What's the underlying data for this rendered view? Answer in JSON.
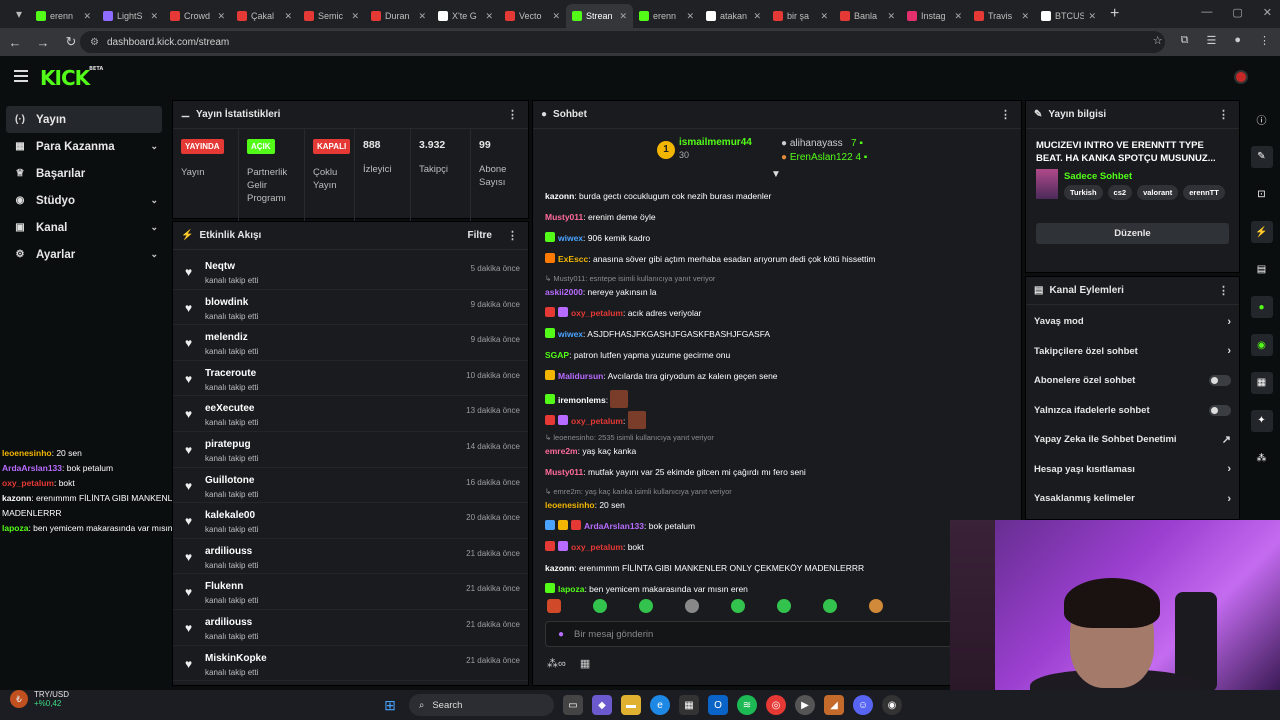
{
  "browser": {
    "tabs": [
      {
        "label": "erenn",
        "color": "#53fc18"
      },
      {
        "label": "LightS",
        "color": "#8e6cff"
      },
      {
        "label": "Crowd",
        "color": "#e53935"
      },
      {
        "label": "Çakal",
        "color": "#e53935"
      },
      {
        "label": "Semic",
        "color": "#e53935"
      },
      {
        "label": "Duran",
        "color": "#e53935"
      },
      {
        "label": "X'te G",
        "color": "#ffffff"
      },
      {
        "label": "Vecto",
        "color": "#e53935"
      },
      {
        "label": "Strean",
        "color": "#53fc18",
        "active": true
      },
      {
        "label": "erenn",
        "color": "#53fc18"
      },
      {
        "label": "atakan",
        "color": "#ffffff"
      },
      {
        "label": "bir şa",
        "color": "#e53935"
      },
      {
        "label": "Banla",
        "color": "#e53935"
      },
      {
        "label": "Instag",
        "color": "#e1306c"
      },
      {
        "label": "Travis",
        "color": "#e53935"
      },
      {
        "label": "BTCUS",
        "color": "#ffffff"
      }
    ],
    "url": "dashboard.kick.com/stream"
  },
  "brand": {
    "logo": "KICK",
    "beta": "BETA",
    "accent": "#53fc18"
  },
  "sidebar": {
    "items": [
      {
        "label": "Yayın",
        "icon": "broadcast-icon",
        "glyph": "(·)",
        "active": true
      },
      {
        "label": "Para Kazanma",
        "icon": "money-icon",
        "glyph": "▦",
        "chevron": true
      },
      {
        "label": "Başarılar",
        "icon": "trophy-icon",
        "glyph": "♕"
      },
      {
        "label": "Stüdyo",
        "icon": "studio-icon",
        "glyph": "◉",
        "chevron": true
      },
      {
        "label": "Kanal",
        "icon": "channel-icon",
        "glyph": "▣",
        "chevron": true
      },
      {
        "label": "Ayarlar",
        "icon": "gear-icon",
        "glyph": "⚙",
        "chevron": true
      }
    ]
  },
  "overlay_chat": [
    {
      "user": "leoenesinho",
      "color": "#f2b600",
      "text": ": 20 sen"
    },
    {
      "user": "ArdaArslan133",
      "color": "#b86cff",
      "text": ": bok petalum"
    },
    {
      "user": "oxy_petalum",
      "color": "#e53935",
      "text": ": bokt"
    },
    {
      "user": "kazonn",
      "color": "#ffffff",
      "text": ": erenımmm FİLİNTA GIBI MANKENLER ONLY ÇEKMEKÖY MADENLERRR"
    },
    {
      "user": "lapoza",
      "color": "#53fc18",
      "text": ": ben yemicem makarasında var mısın eren"
    }
  ],
  "ticker": {
    "pair": "TRY/USD",
    "change": "+%0,42"
  },
  "stats_panel": {
    "title": "Yayın İstatistikleri",
    "cols": [
      {
        "badge": "YAYINDA",
        "badge_bg": "#e53935",
        "label": "Yayın"
      },
      {
        "badge": "AÇIK",
        "badge_bg": "#53fc18",
        "label": "Partnerlik Gelir Programı"
      },
      {
        "badge": "KAPALI",
        "badge_bg": "#e53935",
        "label": "Çoklu Yayın"
      },
      {
        "value": "888",
        "label": "İzleyici"
      },
      {
        "value": "3.932",
        "label": "Takipçi"
      },
      {
        "value": "99",
        "label": "Abone Sayısı"
      }
    ]
  },
  "events_panel": {
    "title": "Etkinlik Akışı",
    "filter": "Filtre",
    "items": [
      {
        "name": "Neqtw",
        "sub": "kanalı takip etti",
        "time": "5 dakika önce"
      },
      {
        "name": "blowdink",
        "sub": "kanalı takip etti",
        "time": "9 dakika önce"
      },
      {
        "name": "melendiz",
        "sub": "kanalı takip etti",
        "time": "9 dakika önce"
      },
      {
        "name": "Traceroute",
        "sub": "kanalı takip etti",
        "time": "10 dakika önce"
      },
      {
        "name": "eeXecutee",
        "sub": "kanalı takip etti",
        "time": "13 dakika önce"
      },
      {
        "name": "piratepug",
        "sub": "kanalı takip etti",
        "time": "14 dakika önce"
      },
      {
        "name": "Guillotone",
        "sub": "kanalı takip etti",
        "time": "16 dakika önce"
      },
      {
        "name": "kalekale00",
        "sub": "kanalı takip etti",
        "time": "20 dakika önce"
      },
      {
        "name": "ardiliouss",
        "sub": "kanalı takip etti",
        "time": "21 dakika önce"
      },
      {
        "name": "Flukenn",
        "sub": "kanalı takip etti",
        "time": "21 dakika önce"
      },
      {
        "name": "ardiliouss",
        "sub": "kanalı takip etti",
        "time": "21 dakika önce"
      },
      {
        "name": "MiskinKopke",
        "sub": "kanalı takip etti",
        "time": "21 dakika önce"
      }
    ]
  },
  "chat_panel": {
    "title": "Sohbet",
    "leader1": {
      "rank": "1",
      "name": "ismailmemur44",
      "count": "30"
    },
    "leader2": {
      "name": "alihanayass",
      "count": "7"
    },
    "leader3": {
      "name": "ErenAslan122",
      "count": "4"
    },
    "messages": [
      {
        "user": "kazonn",
        "color": "#ffffff",
        "text": ": burda gectı cocuklugum cok nezih burası madenler"
      },
      {
        "user": "Musty011",
        "color": "#ff6b9a",
        "text": ": erenim deme öyle"
      },
      {
        "user": "wiwex",
        "color": "#4aa3ff",
        "badges": [
          "#53fc18"
        ],
        "text": ": 906 kemik kadro"
      },
      {
        "user": "ExEscc",
        "color": "#f2b600",
        "badges": [
          "#ff7a00"
        ],
        "text": ": anasına söver gibi açtım merhaba esadan arıyorum dedi çok kötü hissettim"
      },
      {
        "reply": "↳ Musty011: esntepe isimli kullanıcıya yanıt veriyor"
      },
      {
        "user": "askii2000",
        "color": "#b86cff",
        "text": ": nereye yakınsın la"
      },
      {
        "user": "oxy_petalum",
        "color": "#e53935",
        "badges": [
          "#e53935",
          "#b86cff"
        ],
        "text": ": acık adres veriyolar"
      },
      {
        "user": "wiwex",
        "color": "#4aa3ff",
        "badges": [
          "#53fc18"
        ],
        "text": ": ASJDFHASJFKGASHJFGASKFBASHJFGASFA"
      },
      {
        "user": "SGAP",
        "color": "#53fc18",
        "text": ": patron lutfen yapma yuzume gecirme onu"
      },
      {
        "user": "Malidursun",
        "color": "#b86cff",
        "badges": [
          "#f2b600"
        ],
        "text": ": Avcılarda tıra giryodum az kaleın geçen sene"
      },
      {
        "user": "iremonlems",
        "color": "#ffffff",
        "badges": [
          "#53fc18"
        ],
        "text": ":",
        "emote": true
      },
      {
        "user": "oxy_petalum",
        "color": "#e53935",
        "badges": [
          "#e53935",
          "#b86cff"
        ],
        "text": ":",
        "emote": true
      },
      {
        "reply": "↳ leoenesinho: 2535 isimli kullanıcıya yanıt veriyor"
      },
      {
        "user": "emre2m",
        "color": "#ff6b9a",
        "text": ": yaş kaç kanka"
      },
      {
        "user": "Musty011",
        "color": "#ff6b9a",
        "text": ": mutfak yayını var 25 ekimde gitcen mi çağırdı mı fero seni"
      },
      {
        "reply": "↳ emre2m: yaş kaç kanka isimli kullanıcıya yanıt veriyor"
      },
      {
        "user": "leoenesinho",
        "color": "#f2b600",
        "text": ": 20 sen"
      },
      {
        "user": "ArdaArslan133",
        "color": "#b86cff",
        "badges": [
          "#4aa3ff",
          "#f2b600",
          "#e53935"
        ],
        "text": ": bok petalum"
      },
      {
        "user": "oxy_petalum",
        "color": "#e53935",
        "badges": [
          "#e53935",
          "#b86cff"
        ],
        "text": ": bokt"
      },
      {
        "user": "kazonn",
        "color": "#ffffff",
        "text": ": erenımmm FİLİNTA GIBI MANKENLER ONLY ÇEKMEKÖY MADENLERRR"
      },
      {
        "user": "lapoza",
        "color": "#53fc18",
        "badges": [
          "#53fc18"
        ],
        "text": ": ben yemicem makarasında var mısın eren"
      }
    ],
    "input_placeholder": "Bir mesaj gönderin"
  },
  "info_panel": {
    "title": "Yayın bilgisi",
    "stream_title": "MUCIZEVI INTRO VE ERENNTT TYPE BEAT. HA KANKA SPOTÇU MUSUNUZ...",
    "category": "Sadece Sohbet",
    "tags": [
      "Turkish",
      "cs2",
      "valorant",
      "erennTT"
    ],
    "edit": "Düzenle"
  },
  "actions_panel": {
    "title": "Kanal Eylemleri",
    "items": [
      {
        "label": "Yavaş mod",
        "type": "arrow"
      },
      {
        "label": "Takipçilere özel sohbet",
        "type": "arrow"
      },
      {
        "label": "Abonelere özel sohbet",
        "type": "toggle"
      },
      {
        "label": "Yalnızca ifadelerle sohbet",
        "type": "toggle"
      },
      {
        "label": "Yapay Zeka ile Sohbet Denetimi",
        "type": "ext"
      },
      {
        "label": "Hesap yaşı kısıtlaması",
        "type": "arrow"
      },
      {
        "label": "Yasaklanmış kelimeler",
        "type": "arrow"
      }
    ]
  },
  "taskbar": {
    "search": "Search"
  }
}
